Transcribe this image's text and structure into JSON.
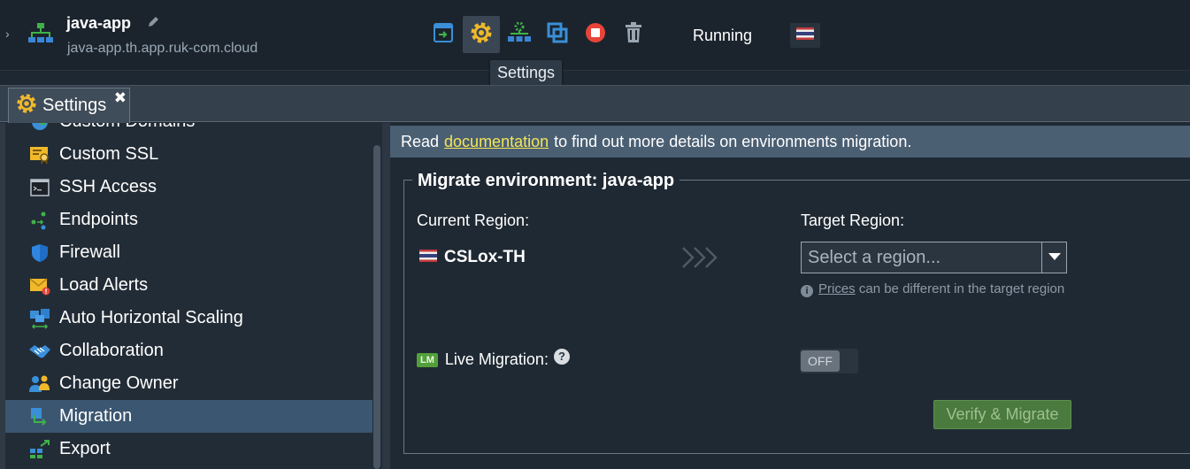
{
  "header": {
    "env_name": "java-app",
    "env_domain": "java-app.th.app.ruk-com.cloud",
    "status": "Running",
    "tooltip": "Settings",
    "toolbar_icons": [
      "open-in-browser-icon",
      "settings-gear-icon",
      "change-topology-icon",
      "clone-icon",
      "stop-icon",
      "delete-icon"
    ],
    "flag_icon": "thailand-flag-icon"
  },
  "tab": {
    "label": "Settings",
    "close": "✖"
  },
  "sidebar": {
    "items": [
      {
        "label": "Custom Domains",
        "icon": "globe-icon"
      },
      {
        "label": "Custom SSL",
        "icon": "ssl-certificate-icon"
      },
      {
        "label": "SSH Access",
        "icon": "terminal-icon"
      },
      {
        "label": "Endpoints",
        "icon": "endpoints-icon"
      },
      {
        "label": "Firewall",
        "icon": "shield-icon"
      },
      {
        "label": "Load Alerts",
        "icon": "mail-alert-icon"
      },
      {
        "label": "Auto Horizontal Scaling",
        "icon": "scaling-icon"
      },
      {
        "label": "Collaboration",
        "icon": "handshake-icon"
      },
      {
        "label": "Change Owner",
        "icon": "users-icon"
      },
      {
        "label": "Migration",
        "icon": "migration-icon",
        "selected": true
      },
      {
        "label": "Export",
        "icon": "export-icon"
      }
    ]
  },
  "main": {
    "info": {
      "prefix": "Read",
      "link": "documentation",
      "suffix": "to find out more details on environments migration."
    },
    "legend": "Migrate environment: java-app",
    "current_region_label": "Current Region:",
    "current_region_value": "CSLox-TH",
    "target_region_label": "Target Region:",
    "target_region_placeholder": "Select a region...",
    "note_link": "Prices",
    "note_text": "can be different in the target region",
    "live_migration_badge": "LM",
    "live_migration_label": "Live Migration:",
    "help": "?",
    "toggle_state": "OFF",
    "verify_button": "Verify & Migrate"
  },
  "colors": {
    "accent_yellow": "#f0b92a",
    "link_yellow": "#f2e65a",
    "selected_row": "#3b5670",
    "button_green": "#4a7a3d"
  }
}
